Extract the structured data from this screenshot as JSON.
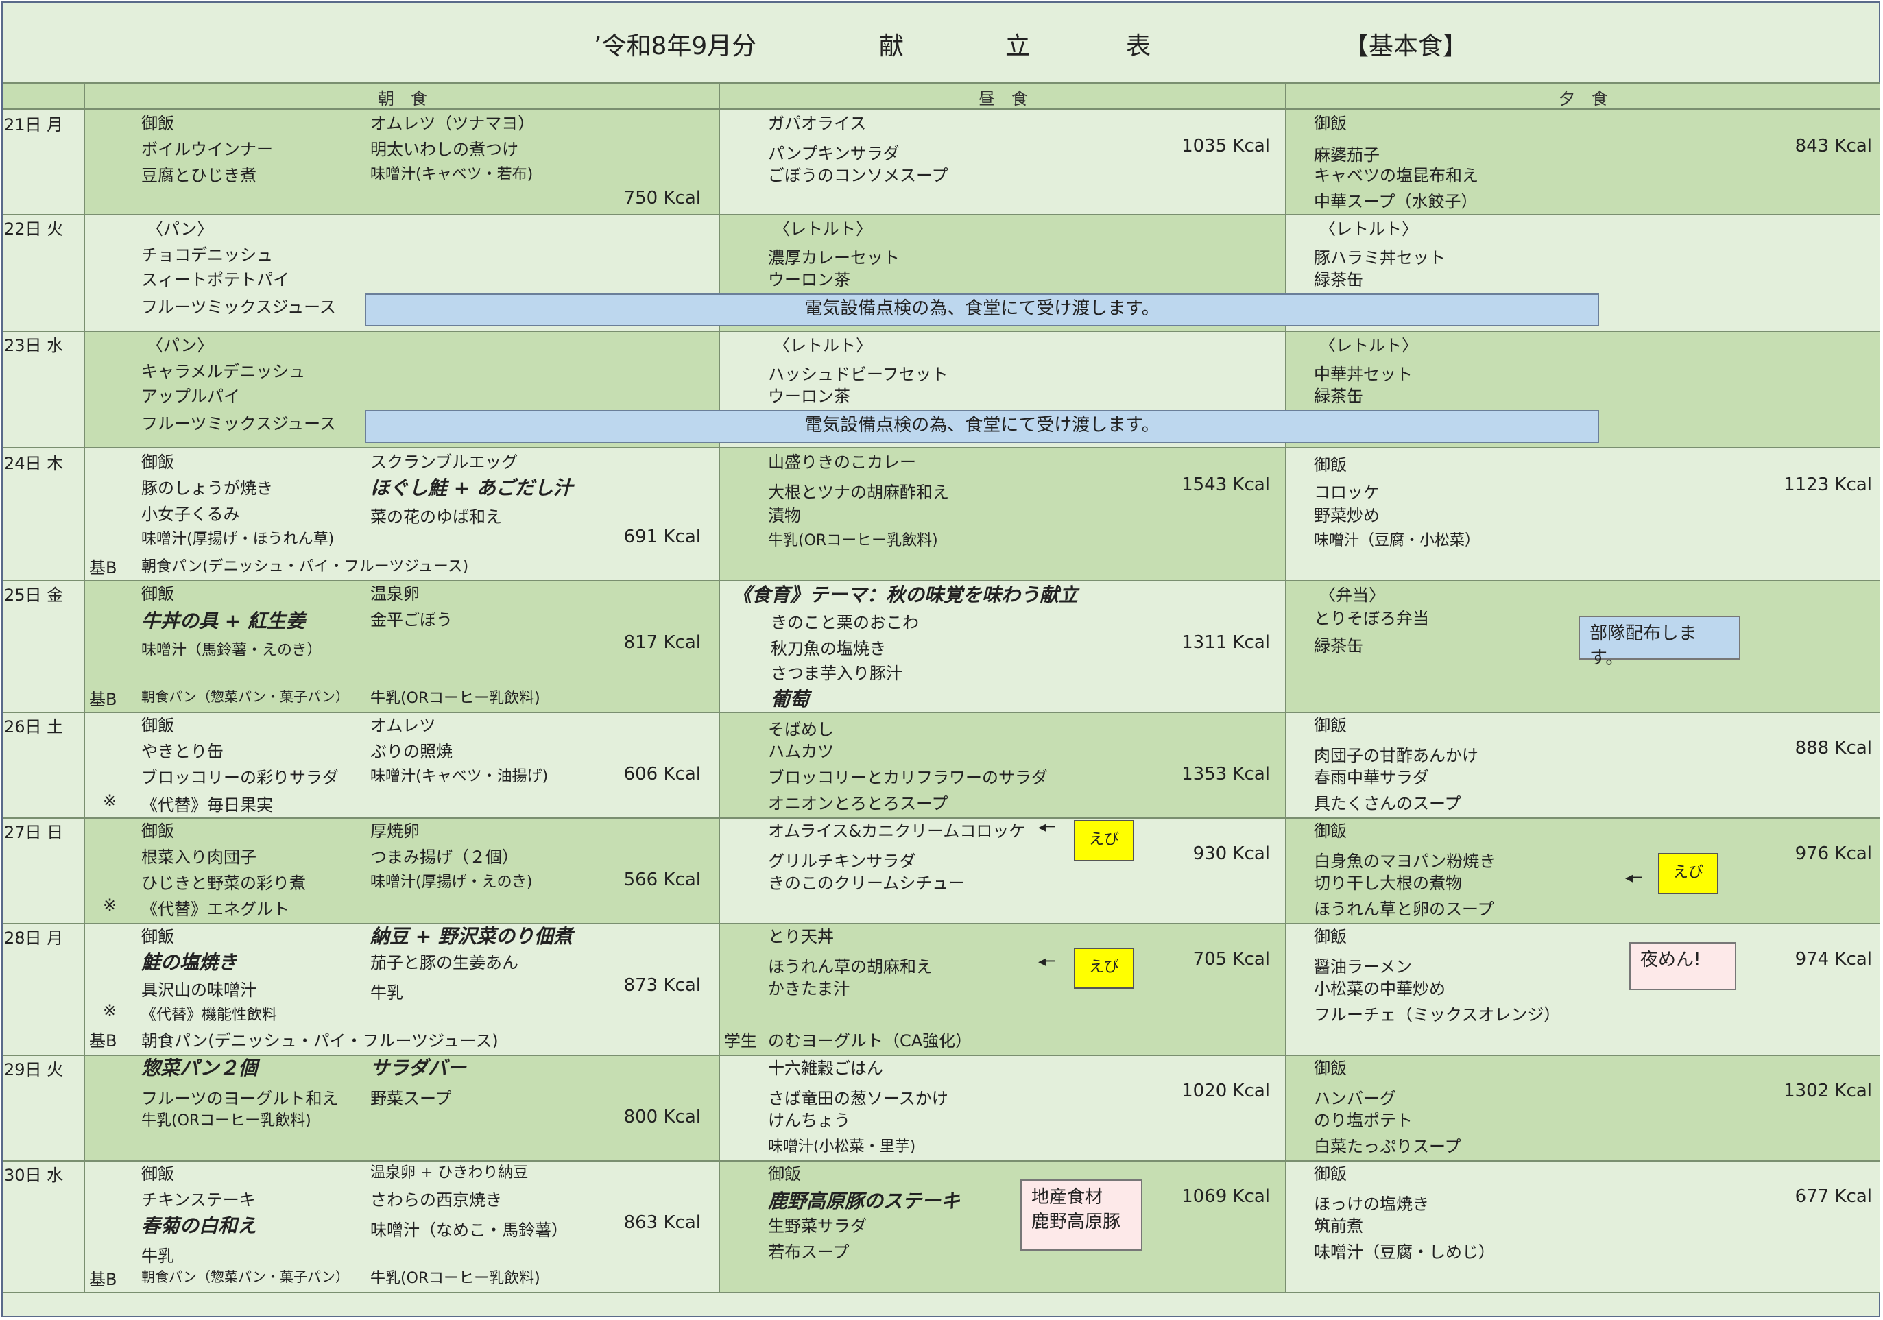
{
  "title": {
    "month": "’令和8年9月分",
    "c1": "献",
    "c2": "立",
    "c3": "表",
    "type": "【基本食】"
  },
  "headers": {
    "breakfast": "朝　食",
    "lunch": "昼　食",
    "dinner": "夕　食"
  },
  "days": {
    "d21": "21日 月",
    "d22": "22日 火",
    "d23": "23日 水",
    "d24": "24日 木",
    "d25": "25日 金",
    "d26": "26日 土",
    "d27": "27日 日",
    "d28": "28日 月",
    "d29": "29日 火",
    "d30": "30日 水"
  },
  "r21": {
    "b": [
      "御飯",
      "ボイルウインナー",
      "豆腐とひじき煮",
      "オムレツ（ツナマヨ）",
      "明太いわしの煮つけ",
      "味噌汁(キャベツ・若布)"
    ],
    "bk": "750 Kcal",
    "l": [
      "ガパオライス",
      "パンプキンサラダ",
      "ごぼうのコンソメスープ"
    ],
    "lk": "1035 Kcal",
    "d": [
      "御飯",
      "麻婆茄子",
      "キャベツの塩昆布和え",
      "中華スープ（水餃子）"
    ],
    "dk": "843 Kcal"
  },
  "r22": {
    "b": [
      "〈パン〉",
      "チョコデニッシュ",
      "スィートポテトパイ",
      "フルーツミックスジュース"
    ],
    "l": [
      "〈レトルト〉",
      "濃厚カレーセット",
      "ウーロン茶"
    ],
    "d": [
      "〈レトルト〉",
      "豚ハラミ丼セット",
      "緑茶缶"
    ],
    "notice": "電気設備点検の為、食堂にて受け渡します。"
  },
  "r23": {
    "b": [
      "〈パン〉",
      "キャラメルデニッシュ",
      "アップルパイ",
      "フルーツミックスジュース"
    ],
    "l": [
      "〈レトルト〉",
      "ハッシュドビーフセット",
      "ウーロン茶"
    ],
    "d": [
      "〈レトルト〉",
      "中華丼セット",
      "緑茶缶"
    ],
    "notice": "電気設備点検の為、食堂にて受け渡します。"
  },
  "r24": {
    "b": [
      "御飯",
      "豚のしょうが焼き",
      "小女子くるみ",
      "味噌汁(厚揚げ・ほうれん草)",
      "スクランブルエッグ",
      "ほぐし鮭 + あごだし汁",
      "菜の花のゆば和え"
    ],
    "bk": "691 Kcal",
    "kb": "基B",
    "kbt": "朝食パン(デニッシュ・パイ・フルーツジュース)",
    "l": [
      "山盛りきのこカレー",
      "大根とツナの胡麻酢和え",
      "漬物",
      "牛乳(ORコーヒー乳飲料)"
    ],
    "lk": "1543 Kcal",
    "d": [
      "御飯",
      "コロッケ",
      "野菜炒め",
      "味噌汁（豆腐・小松菜）"
    ],
    "dk": "1123 Kcal"
  },
  "r25": {
    "b": [
      "御飯",
      "牛丼の具 + 紅生姜",
      "味噌汁（馬鈴薯・えのき）",
      "温泉卵",
      "金平ごぼう"
    ],
    "bk": "817 Kcal",
    "kb": "基B",
    "kbt": "朝食パン（惣菜パン・菓子パン）",
    "kbt2": "牛乳(ORコーヒー乳飲料)",
    "l": [
      "《食育》テーマ：秋の味覚を味わう献立",
      "きのこと栗のおこわ",
      "秋刀魚の塩焼き",
      "さつま芋入り豚汁",
      "葡萄"
    ],
    "lk": "1311 Kcal",
    "d": [
      "〈弁当〉",
      "とりそぼろ弁当",
      "緑茶缶"
    ],
    "note": "部隊配布します。"
  },
  "r26": {
    "b": [
      "御飯",
      "やきとり缶",
      "ブロッコリーの彩りサラダ",
      "オムレツ",
      "ぶりの照焼",
      "味噌汁(キャベツ・油揚げ)"
    ],
    "bk": "606 Kcal",
    "mark": "※",
    "sub": "《代替》毎日果実",
    "l": [
      "そばめし",
      "ハムカツ",
      "ブロッコリーとカリフラワーのサラダ",
      "オニオンとろとろスープ"
    ],
    "lk": "1353 Kcal",
    "d": [
      "御飯",
      "肉団子の甘酢あんかけ",
      "春雨中華サラダ",
      "具たくさんのスープ"
    ],
    "dk": "888 Kcal"
  },
  "r27": {
    "b": [
      "御飯",
      "根菜入り肉団子",
      "ひじきと野菜の彩り煮",
      "厚焼卵",
      "つまみ揚げ（２個）",
      "味噌汁(厚揚げ・えのき)"
    ],
    "bk": "566 Kcal",
    "mark": "※",
    "sub": "《代替》エネグルト",
    "l": [
      "オムライス&カニクリームコロッケ",
      "グリルチキンサラダ",
      "きのこのクリームシチュー"
    ],
    "lk": "930 Kcal",
    "d": [
      "御飯",
      "白身魚のマヨパン粉焼き",
      "切り干し大根の煮物",
      "ほうれん草と卵のスープ"
    ],
    "dk": "976 Kcal",
    "ebi": "えび"
  },
  "r28": {
    "b": [
      "御飯",
      "鮭の塩焼き",
      "具沢山の味噌汁",
      "納豆 + 野沢菜のり佃煮",
      "茄子と豚の生姜あん",
      "牛乳"
    ],
    "bk": "873 Kcal",
    "mark": "※",
    "sub": "《代替》機能性飲料",
    "kb": "基B",
    "kbt": "朝食パン(デニッシュ・パイ・フルーツジュース)",
    "l": [
      "とり天丼",
      "ほうれん草の胡麻和え",
      "かきたま汁"
    ],
    "lk": "705 Kcal",
    "gs": "学生",
    "gst": "のむヨーグルト（CA強化）",
    "d": [
      "御飯",
      "醤油ラーメン",
      "小松菜の中華炒め",
      "フルーチェ（ミックスオレンジ）"
    ],
    "dk": "974 Kcal",
    "note": "夜めん!",
    "ebi": "えび"
  },
  "r29": {
    "b": [
      "惣菜パン２個",
      "フルーツのヨーグルト和え",
      "牛乳(ORコーヒー乳飲料)",
      "サラダバー",
      "野菜スープ"
    ],
    "bk": "800 Kcal",
    "l": [
      "十六雑穀ごはん",
      "さば竜田の葱ソースかけ",
      "けんちょう",
      "味噌汁(小松菜・里芋)"
    ],
    "lk": "1020 Kcal",
    "d": [
      "御飯",
      "ハンバーグ",
      "のり塩ポテト",
      "白菜たっぷりスープ"
    ],
    "dk": "1302 Kcal"
  },
  "r30": {
    "b": [
      "御飯",
      "チキンステーキ",
      "春菊の白和え",
      "牛乳",
      "温泉卵 + ひきわり納豆",
      "さわらの西京焼き",
      "味噌汁（なめこ・馬鈴薯）"
    ],
    "bk": "863 Kcal",
    "kb": "基B",
    "kbt": "朝食パン（惣菜パン・菓子パン）",
    "kbt2": "牛乳(ORコーヒー乳飲料)",
    "l": [
      "御飯",
      "鹿野高原豚のステーキ",
      "生野菜サラダ",
      "若布スープ"
    ],
    "lk": "1069 Kcal",
    "note1": "地産食材",
    "note2": "鹿野高原豚",
    "d": [
      "御飯",
      "ほっけの塩焼き",
      "筑前煮",
      "味噌汁（豆腐・しめじ）"
    ],
    "dk": "677 Kcal"
  }
}
